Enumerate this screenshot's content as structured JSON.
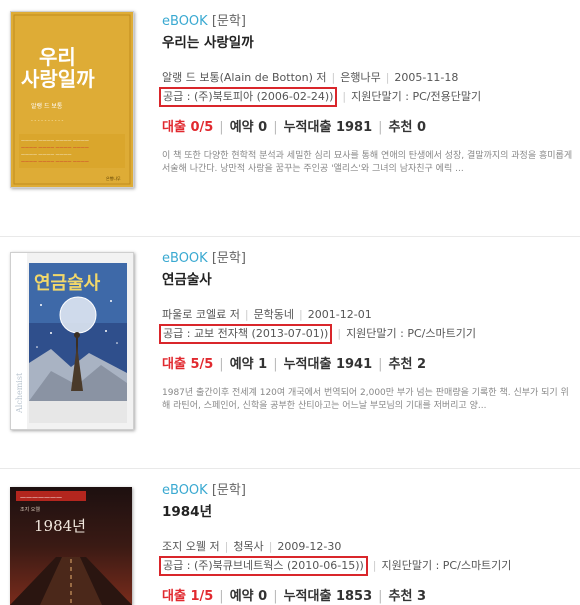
{
  "books": [
    {
      "format": "eBOOK",
      "genre": "[문학]",
      "title": "우리는 사랑일까",
      "author": "알랭 드 보통(Alain de Botton) 저",
      "publisher": "은행나무",
      "pub_date": "2005-11-18",
      "supply": "공급 : (주)북토피아 (2006-02-24))",
      "device": "지원단말기 : PC/전용단말기",
      "loan": "대출 0/5",
      "reserve": "예약 0",
      "total": "누적대출 1981",
      "recommend": "추천 0",
      "description": "이 책 또한 다양한 현학적 분석과 세밀한 심리 묘사를 통해 연애의 탄생에서 성장, 결말까지의 과정을 흥미롭게 서술해 나간다. 낭만적 사랑을 꿈꾸는 주인공 '앨리스'와 그녀의 남자친구 에릭 ...",
      "cover_title": "우리는 사랑일까"
    },
    {
      "format": "eBOOK",
      "genre": "[문학]",
      "title": "연금술사",
      "author": "파울로 코엘료 저",
      "publisher": "문학동네",
      "pub_date": "2001-12-01",
      "supply": "공급 : 교보 전자책 (2013-07-01))",
      "device": "지원단말기 : PC/스마트기기",
      "loan": "대출 5/5",
      "reserve": "예약 1",
      "total": "누적대출 1941",
      "recommend": "추천 2",
      "description": "1987년 출간이후 전세계 120여 개국에서 번역되어 2,000만 부가 넘는 판매량을 기록한 책. 신부가 되기 위해 라틴어, 스페인어, 신학을 공부한 산티아고는 어느날 부모님의 기대를 저버리고 양...",
      "cover_title": "연금술사",
      "cover_spine": "Alchemist"
    },
    {
      "format": "eBOOK",
      "genre": "[문학]",
      "title": "1984년",
      "author": "조지 오웰 저",
      "publisher": "청목사",
      "pub_date": "2009-12-30",
      "supply": "공급 : (주)북큐브네트웍스 (2010-06-15))",
      "device": "지원단말기 : PC/스마트기기",
      "loan": "대출 1/5",
      "reserve": "예약 0",
      "total": "누적대출 1853",
      "recommend": "추천 3",
      "cover_title": "1984년"
    }
  ],
  "colors": {
    "accent": "#3aa9d1",
    "loan": "#e1292f",
    "highlight_box": "#d9262b"
  }
}
